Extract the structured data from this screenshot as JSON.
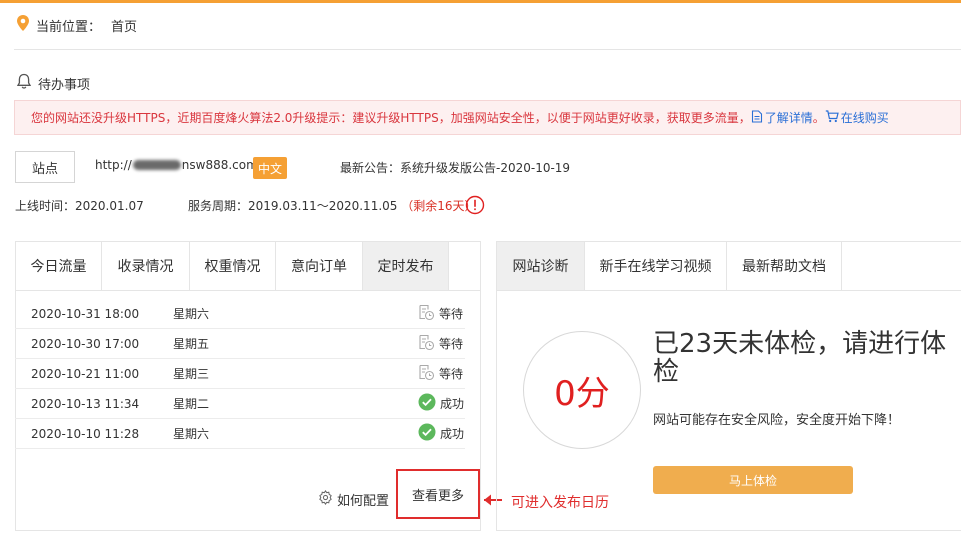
{
  "breadcrumb": {
    "label": "当前位置：",
    "current": "首页"
  },
  "todo": {
    "title": "待办事项"
  },
  "notice": {
    "text": "您的网站还没升级HTTPS，近期百度烽火算法2.0升级提示：建议升级HTTPS，加强网站安全性，以便于网站更好收录，获取更多流量，",
    "detail_link": "了解详情",
    "buy_link": "在线购买"
  },
  "site": {
    "button": "站点",
    "url_prefix": "http://",
    "url_suffix": "nsw888.com",
    "lang": "中文",
    "announcement": "最新公告：系统升级发版公告-2020-10-19"
  },
  "service_info": {
    "online_label": "上线时间：2020.01.07",
    "period_label": "服务周期：2019.03.11～2020.11.05",
    "remaining": "（剩余16天）"
  },
  "left_panel": {
    "tabs": [
      "今日流量",
      "收录情况",
      "权重情况",
      "意向订单",
      "定时发布"
    ],
    "active_tab": "定时发布",
    "rows": [
      {
        "datetime": "2020-10-31 18:00",
        "weekday": "星期六",
        "status": "等待"
      },
      {
        "datetime": "2020-10-30 17:00",
        "weekday": "星期五",
        "status": "等待"
      },
      {
        "datetime": "2020-10-21 11:00",
        "weekday": "星期三",
        "status": "等待"
      },
      {
        "datetime": "2020-10-13 11:34",
        "weekday": "星期二",
        "status": "成功"
      },
      {
        "datetime": "2020-10-10 11:28",
        "weekday": "星期六",
        "status": "成功"
      }
    ],
    "config_link": "如何配置",
    "more_link": "查看更多"
  },
  "annotation": {
    "text": "可进入发布日历"
  },
  "right_panel": {
    "tabs": [
      "网站诊断",
      "新手在线学习视频",
      "最新帮助文档"
    ],
    "active_tab": "网站诊断",
    "score": "0分",
    "title": "已23天未体检，请进行体检",
    "desc": "网站可能存在安全风险，安全度开始下降！",
    "button": "马上体检"
  },
  "colors": {
    "accent": "#f5a034",
    "danger": "#e02d2d",
    "link": "#2a6fd6",
    "success": "#5cb85c"
  }
}
